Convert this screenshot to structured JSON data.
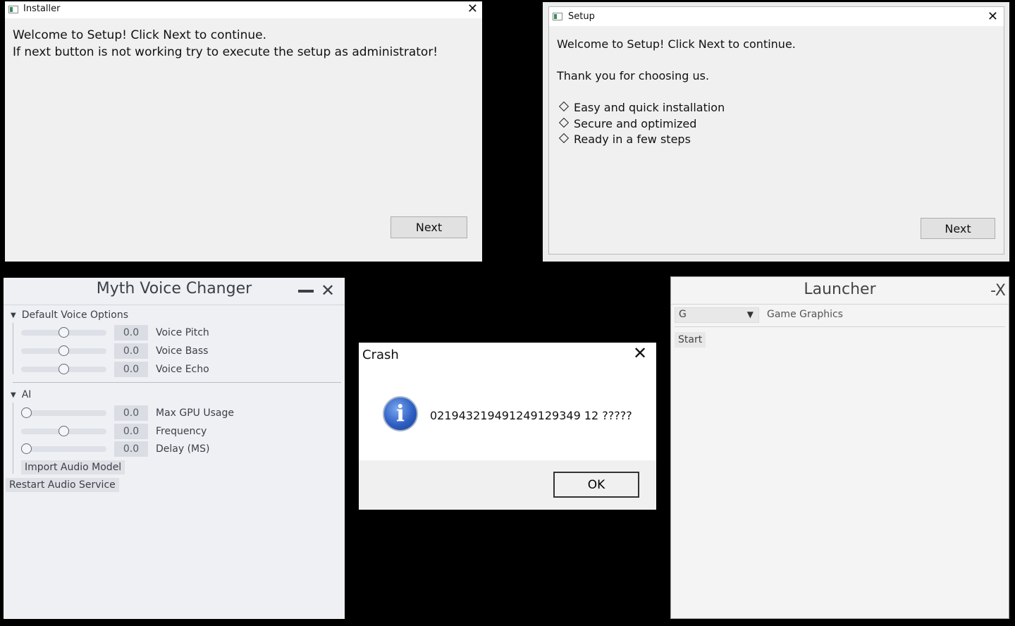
{
  "installer": {
    "title": "Installer",
    "close": "✕",
    "line1": "Welcome to Setup! Click Next to continue.",
    "line2": "If next button is not working try to execute the setup as administrator!",
    "next": "Next"
  },
  "setup": {
    "title": "Setup",
    "close": "✕",
    "line1": "Welcome to Setup! Click Next to continue.",
    "line2": "Thank you for choosing us.",
    "features": [
      "Easy and quick installation",
      "Secure and optimized",
      "Ready in a few steps"
    ],
    "next": "Next"
  },
  "myth": {
    "title": "Myth Voice Changer",
    "close": "✕",
    "group1": "Default Voice Options",
    "group2": "AI",
    "collapse_glyph": "▼",
    "params": [
      {
        "label": "Voice Pitch",
        "value": "0.0",
        "level": 0.5
      },
      {
        "label": "Voice Bass",
        "value": "0.0",
        "level": 0.5
      },
      {
        "label": "Voice Echo",
        "value": "0.0",
        "level": 0.5
      },
      {
        "label": "Max GPU Usage",
        "value": "0.0",
        "level": 0.0
      },
      {
        "label": "Frequency",
        "value": "0.0",
        "level": 0.5
      },
      {
        "label": "Delay (MS)",
        "value": "0.0",
        "level": 0.0
      }
    ],
    "import_btn": "Import Audio Model",
    "restart_btn": "Restart Audio Service"
  },
  "crash": {
    "title": "Crash",
    "close": "✕",
    "icon": "i",
    "message": "021943219491249129349 12 ?????",
    "ok": "OK"
  },
  "launcher": {
    "title": "Launcher",
    "close": "-X",
    "combo_value": "G",
    "combo_arrow": "▼",
    "combo_label": "Game Graphics",
    "start": "Start"
  },
  "colors": {
    "desktop": "#000000",
    "myth_bg": "#eef0f4",
    "info_blue": "#2f5fc4"
  }
}
